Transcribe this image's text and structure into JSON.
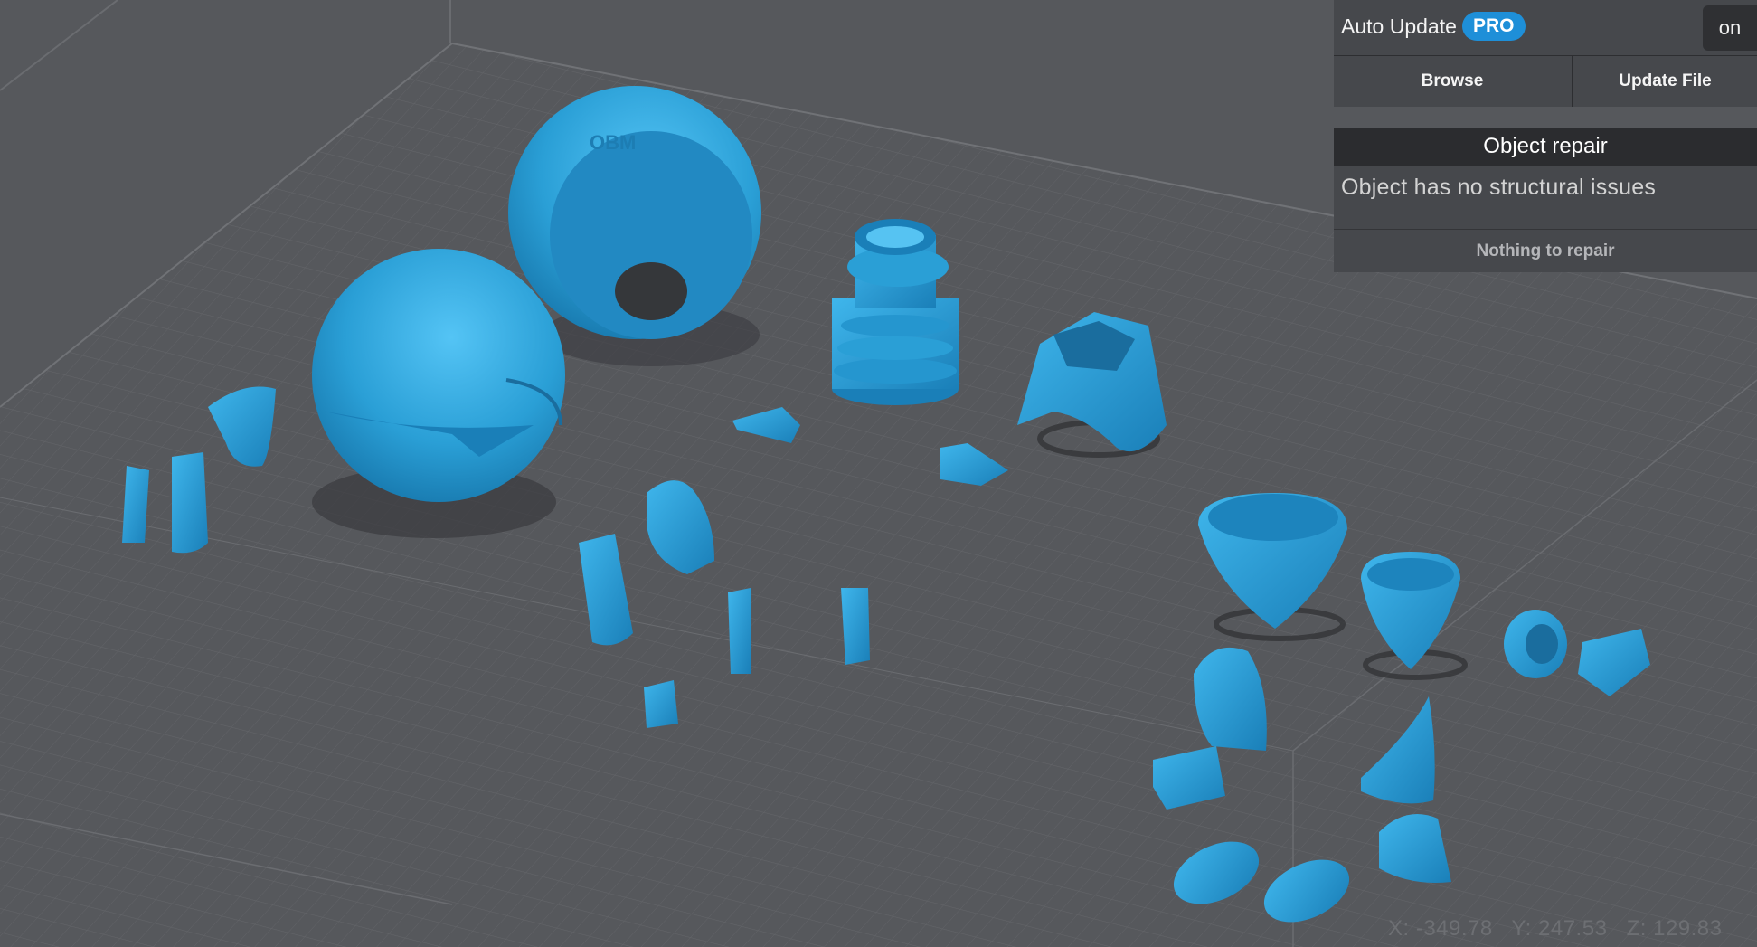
{
  "auto_update": {
    "label": "Auto Update",
    "badge": "PRO",
    "toggle_state": "on",
    "browse_label": "Browse",
    "update_file_label": "Update File"
  },
  "object_repair": {
    "title": "Object repair",
    "message": "Object has no structural issues",
    "repair_button": "Nothing to repair"
  },
  "coordinates": {
    "x": "X: -349.78",
    "y": "Y: 247.53",
    "z": "Z: 129.83"
  },
  "colors": {
    "background": "#56585c",
    "model": "#2a9fd6",
    "accent": "#1e8fd8"
  }
}
